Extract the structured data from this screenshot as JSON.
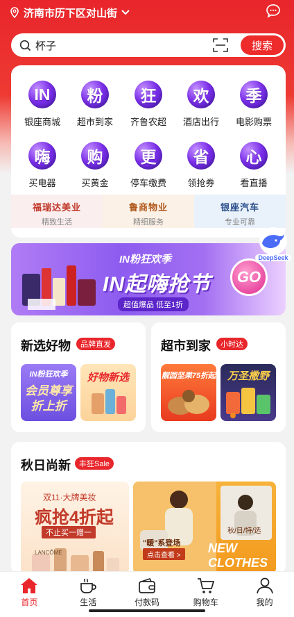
{
  "header": {
    "location": "济南市历下区对山街",
    "location_icon": "map-pin-icon",
    "message_icon": "chat-bubble-icon"
  },
  "search": {
    "query": "杯子",
    "button_label": "搜索",
    "scan_icon": "scan-icon"
  },
  "categories": [
    {
      "glyph": "IN",
      "label": "银座商城"
    },
    {
      "glyph": "粉",
      "label": "超市到家"
    },
    {
      "glyph": "狂",
      "label": "齐鲁农超"
    },
    {
      "glyph": "欢",
      "label": "酒店出行"
    },
    {
      "glyph": "季",
      "label": "电影购票"
    },
    {
      "glyph": "嗨",
      "label": "买电器"
    },
    {
      "glyph": "购",
      "label": "买黄金"
    },
    {
      "glyph": "更",
      "label": "停车缴费"
    },
    {
      "glyph": "省",
      "label": "领抢券"
    },
    {
      "glyph": "心",
      "label": "看直播"
    }
  ],
  "brands": [
    {
      "name": "福瑞达美业",
      "sub": "精致生活",
      "color": "#c0392b"
    },
    {
      "name": "鲁商物业",
      "sub": "精细服务",
      "color": "#b05a1e"
    },
    {
      "name": "银座汽车",
      "sub": "专业可靠",
      "color": "#2a4f8a"
    }
  ],
  "deepseek": {
    "label": "DeepSeek"
  },
  "banner": {
    "title_small": "IN粉狂欢季",
    "title_big": "IN起嗨抢节",
    "pill": "超值爆品 低至1折",
    "go": "GO"
  },
  "sections": {
    "new_goods": {
      "title": "新选好物",
      "tag": "品牌直发",
      "thumb1_top": "IN粉狂欢季",
      "thumb1_main": "会员尊享",
      "thumb1_sub": "折上折",
      "thumb2_main": "好物新选"
    },
    "supermarket": {
      "title": "超市到家",
      "tag": "小时达",
      "thumb1_main": "靓园坚果75折起",
      "thumb2_main": "万圣撒野"
    },
    "autumn": {
      "title": "秋日尚新",
      "tag": "丰狂Sale",
      "promo1_top": "双11·大牌美妆",
      "promo1_main": "疯抢4折起",
      "promo1_sub": "不止买一赠一",
      "promo2_a": "\"暖\"系登场",
      "promo2_b": "点击查看 >",
      "promo2_c": "NEW CLOTHES",
      "promo2_d": "秋/日/特/选",
      "promo1_brand": "LANCÔME"
    }
  },
  "tabbar": [
    {
      "label": "首页",
      "icon": "home-icon",
      "active": true
    },
    {
      "label": "生活",
      "icon": "coffee-cup-icon",
      "active": false
    },
    {
      "label": "付款码",
      "icon": "wallet-icon",
      "active": false
    },
    {
      "label": "购物车",
      "icon": "cart-icon",
      "active": false
    },
    {
      "label": "我的",
      "icon": "user-icon",
      "active": false
    }
  ],
  "colors": {
    "primary": "#e8262b",
    "accent": "#7a2ee8"
  }
}
